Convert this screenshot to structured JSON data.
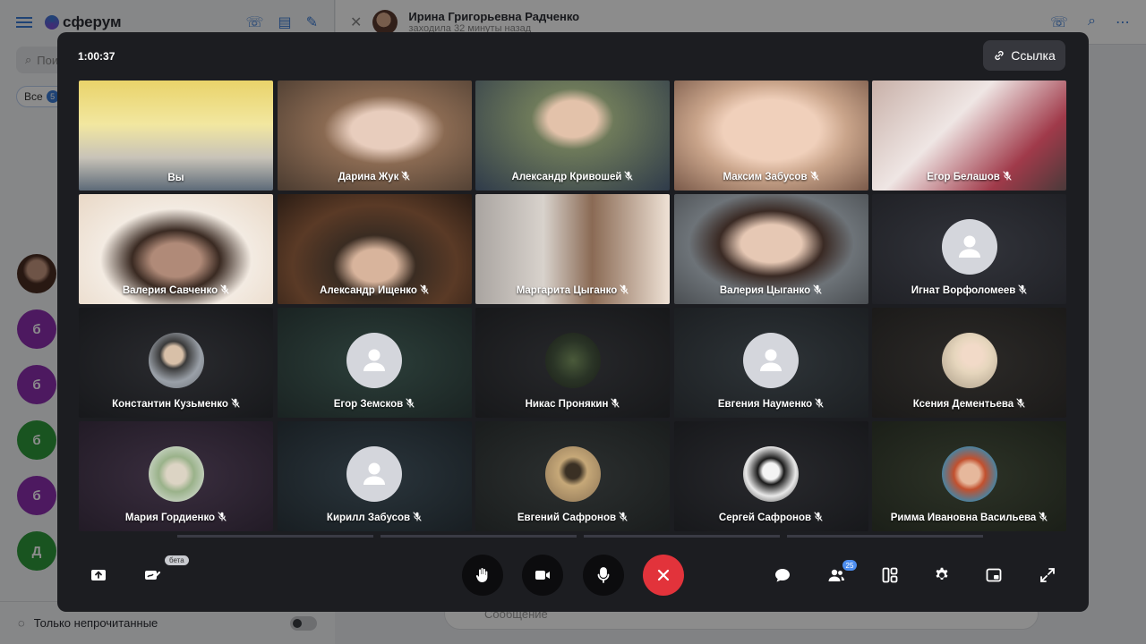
{
  "sidebar": {
    "brand": "сферум",
    "search_placeholder": "Поиск",
    "filter_chip": {
      "label": "Все",
      "count": "5"
    },
    "chat_avatars": [
      {
        "letter": "",
        "color": "#5a3a2e",
        "top": 0
      },
      {
        "letter": "б",
        "color": "#8c2fb0"
      },
      {
        "letter": "б",
        "color": "#8c2fb0"
      },
      {
        "letter": "б",
        "color": "#2e9a3b"
      },
      {
        "letter": "б",
        "color": "#8c2fb0"
      },
      {
        "letter": "Д",
        "color": "#2e9a3b"
      }
    ],
    "unread_only_label": "Только непрочитанные"
  },
  "chat": {
    "name": "Ирина Григорьевна Радченко",
    "status": "заходила 32 минуты назад",
    "message_placeholder": "Сообщение"
  },
  "call": {
    "timer": "1:00:37",
    "link_label": "Ссылка",
    "participants_count": "25",
    "beta_label": "бета",
    "participants": [
      {
        "name": "Вы",
        "kind": "video",
        "bg": "linear-gradient(180deg,#e9d36a 0%,#f2e7a0 40%,#c8c3b8 70%,#5d6a78 100%)",
        "muted": false
      },
      {
        "name": "Дарина Жук",
        "kind": "video",
        "bg": "radial-gradient(ellipse at 55% 45%,#e8cdbd 0 22%,#8a6a52 40%,#4a3b30 100%)",
        "muted": true
      },
      {
        "name": "Александр Кривошей",
        "kind": "video",
        "bg": "radial-gradient(ellipse at 50% 35%,#e3c2aa 0 18%,#6e7a5a 30%,#2f3b4a 100%)",
        "muted": true
      },
      {
        "name": "Максим Забусов",
        "kind": "video",
        "bg": "radial-gradient(ellipse at 50% 45%,#f0d0bb 0 35%,#c9a48a 55%,#7a5a4a 100%)",
        "muted": true
      },
      {
        "name": "Егор Белашов",
        "kind": "video",
        "bg": "linear-gradient(135deg,#c8b0a8 0%,#efe6e4 40%,#a03a4a 75%,#4a3a3a 100%)",
        "muted": true
      },
      {
        "name": "Валерия Савченко",
        "kind": "video",
        "bg": "radial-gradient(ellipse at 50% 60%,#b08a78 0 18%,#3a2a22 32%,#f3ebe2 55%,#e9d8c6 100%)",
        "muted": true
      },
      {
        "name": "Александр Ищенко",
        "kind": "video",
        "bg": "radial-gradient(ellipse at 50% 65%,#d8b49c 0 16%,#3a2c22 30%,#5a3a26 60%,#2a1c14 100%)",
        "muted": true
      },
      {
        "name": "Маргарита Цыганко",
        "kind": "video",
        "bg": "linear-gradient(90deg,#a9a4a0 0%,#d8d2cc 35%,#8a6a54 60%,#efe2d6 100%)",
        "muted": true
      },
      {
        "name": "Валерия Цыганко",
        "kind": "video",
        "bg": "radial-gradient(ellipse at 50% 45%,#e6c8b4 0 22%,#3a2a24 38%,#6d7378 60%,#4a4e52 100%)",
        "muted": true
      },
      {
        "name": "Игнат Ворфоломеев",
        "kind": "default",
        "bg": "radial-gradient(ellipse at 50% 50%,#32343b 0%,#202126 100%)",
        "muted": true
      },
      {
        "name": "Константин Кузьменко",
        "kind": "photo",
        "bg": "radial-gradient(ellipse at 50% 50%,#2a2b2f 0%,#17181b 100%)",
        "avatar_bg": "radial-gradient(circle at 45% 40%,#d8c0a8 0 20%,#3a3a3a 30%,#9aa0a8 60%,#6a6e74 100%)",
        "muted": true
      },
      {
        "name": "Егор Земсков",
        "kind": "default",
        "bg": "radial-gradient(ellipse at 50% 50%,#2c3f3a 0%,#1a2322 100%)",
        "muted": true
      },
      {
        "name": "Никас Пронякин",
        "kind": "photo",
        "bg": "radial-gradient(ellipse at 50% 50%,#27282b 0%,#17181a 100%)",
        "avatar_bg": "radial-gradient(circle at 50% 50%,#4a5a3a 0%,#2a3426 50%,#1a1e18 100%)",
        "muted": true
      },
      {
        "name": "Евгения Науменко",
        "kind": "default",
        "bg": "radial-gradient(ellipse at 50% 50%,#2e3438 0%,#1c1f22 100%)",
        "muted": true
      },
      {
        "name": "Ксения Дементьева",
        "kind": "photo",
        "bg": "radial-gradient(ellipse at 50% 50%,#2c2a28 0%,#1b1a19 100%)",
        "avatar_bg": "radial-gradient(circle at 55% 40%,#f2dac8 0 22%,#e6d6bd 40%,#a89a86 100%)",
        "muted": true
      },
      {
        "name": "Мария Гордиенко",
        "kind": "photo",
        "bg": "radial-gradient(ellipse at 50% 50%,#3a2e3f 0%,#221b26 100%)",
        "avatar_bg": "radial-gradient(circle at 50% 50%,#dcd4c4 0 25%,#9ab28a 45%,#e8eaea 100%)",
        "muted": true
      },
      {
        "name": "Кирилл Забусов",
        "kind": "default",
        "bg": "radial-gradient(ellipse at 50% 50%,#2a353c 0%,#181e22 100%)",
        "muted": true
      },
      {
        "name": "Евгений Сафронов",
        "kind": "photo",
        "bg": "radial-gradient(ellipse at 50% 50%,#2c3030 0%,#1a1d1d 100%)",
        "avatar_bg": "radial-gradient(circle at 50% 45%,#3a3024 0 18%,#c6a878 35%,#8a7254 100%)",
        "muted": true
      },
      {
        "name": "Сергей Сафронов",
        "kind": "photo",
        "bg": "radial-gradient(ellipse at 50% 50%,#28292d 0%,#17181b 100%)",
        "avatar_bg": "radial-gradient(circle at 50% 45%,#f4f4f4 0 20%,#1a1a1a 32%,#e8e8e8 60%,#2a2a2a 100%)",
        "muted": true
      },
      {
        "name": "Римма Ивановна Васильева",
        "kind": "photo",
        "bg": "radial-gradient(ellipse at 50% 50%,#2d3327 0%,#1b1f18 100%)",
        "avatar_bg": "radial-gradient(circle at 50% 50%,#e6b89c 0 25%,#c2502e 40%,#3a8ab0 75%,#e8d0c0 100%)",
        "muted": true
      }
    ]
  },
  "colors": {
    "accent": "#3a7bd5",
    "end_call": "#e2333b",
    "modal_bg": "#1c1d21"
  }
}
